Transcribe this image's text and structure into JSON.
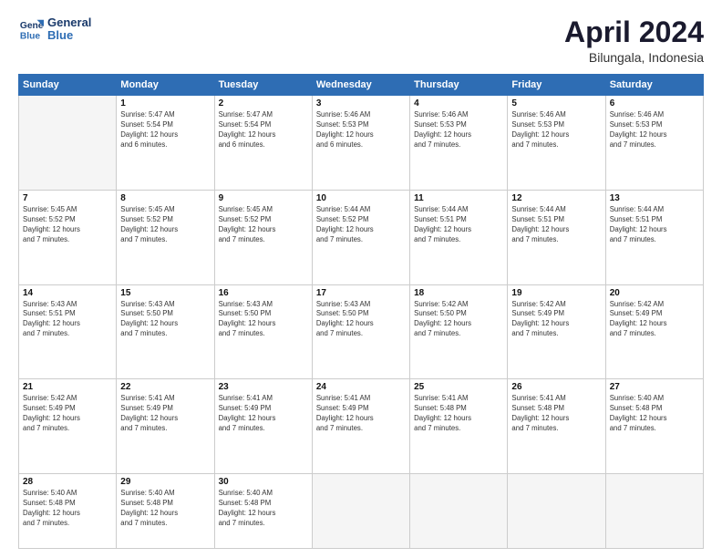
{
  "logo": {
    "line1": "General",
    "line2": "Blue"
  },
  "title": "April 2024",
  "subtitle": "Bilungala, Indonesia",
  "weekdays": [
    "Sunday",
    "Monday",
    "Tuesday",
    "Wednesday",
    "Thursday",
    "Friday",
    "Saturday"
  ],
  "weeks": [
    [
      {
        "day": "",
        "info": ""
      },
      {
        "day": "1",
        "info": "Sunrise: 5:47 AM\nSunset: 5:54 PM\nDaylight: 12 hours\nand 6 minutes."
      },
      {
        "day": "2",
        "info": "Sunrise: 5:47 AM\nSunset: 5:54 PM\nDaylight: 12 hours\nand 6 minutes."
      },
      {
        "day": "3",
        "info": "Sunrise: 5:46 AM\nSunset: 5:53 PM\nDaylight: 12 hours\nand 6 minutes."
      },
      {
        "day": "4",
        "info": "Sunrise: 5:46 AM\nSunset: 5:53 PM\nDaylight: 12 hours\nand 7 minutes."
      },
      {
        "day": "5",
        "info": "Sunrise: 5:46 AM\nSunset: 5:53 PM\nDaylight: 12 hours\nand 7 minutes."
      },
      {
        "day": "6",
        "info": "Sunrise: 5:46 AM\nSunset: 5:53 PM\nDaylight: 12 hours\nand 7 minutes."
      }
    ],
    [
      {
        "day": "7",
        "info": "Sunrise: 5:45 AM\nSunset: 5:52 PM\nDaylight: 12 hours\nand 7 minutes."
      },
      {
        "day": "8",
        "info": "Sunrise: 5:45 AM\nSunset: 5:52 PM\nDaylight: 12 hours\nand 7 minutes."
      },
      {
        "day": "9",
        "info": "Sunrise: 5:45 AM\nSunset: 5:52 PM\nDaylight: 12 hours\nand 7 minutes."
      },
      {
        "day": "10",
        "info": "Sunrise: 5:44 AM\nSunset: 5:52 PM\nDaylight: 12 hours\nand 7 minutes."
      },
      {
        "day": "11",
        "info": "Sunrise: 5:44 AM\nSunset: 5:51 PM\nDaylight: 12 hours\nand 7 minutes."
      },
      {
        "day": "12",
        "info": "Sunrise: 5:44 AM\nSunset: 5:51 PM\nDaylight: 12 hours\nand 7 minutes."
      },
      {
        "day": "13",
        "info": "Sunrise: 5:44 AM\nSunset: 5:51 PM\nDaylight: 12 hours\nand 7 minutes."
      }
    ],
    [
      {
        "day": "14",
        "info": "Sunrise: 5:43 AM\nSunset: 5:51 PM\nDaylight: 12 hours\nand 7 minutes."
      },
      {
        "day": "15",
        "info": "Sunrise: 5:43 AM\nSunset: 5:50 PM\nDaylight: 12 hours\nand 7 minutes."
      },
      {
        "day": "16",
        "info": "Sunrise: 5:43 AM\nSunset: 5:50 PM\nDaylight: 12 hours\nand 7 minutes."
      },
      {
        "day": "17",
        "info": "Sunrise: 5:43 AM\nSunset: 5:50 PM\nDaylight: 12 hours\nand 7 minutes."
      },
      {
        "day": "18",
        "info": "Sunrise: 5:42 AM\nSunset: 5:50 PM\nDaylight: 12 hours\nand 7 minutes."
      },
      {
        "day": "19",
        "info": "Sunrise: 5:42 AM\nSunset: 5:49 PM\nDaylight: 12 hours\nand 7 minutes."
      },
      {
        "day": "20",
        "info": "Sunrise: 5:42 AM\nSunset: 5:49 PM\nDaylight: 12 hours\nand 7 minutes."
      }
    ],
    [
      {
        "day": "21",
        "info": "Sunrise: 5:42 AM\nSunset: 5:49 PM\nDaylight: 12 hours\nand 7 minutes."
      },
      {
        "day": "22",
        "info": "Sunrise: 5:41 AM\nSunset: 5:49 PM\nDaylight: 12 hours\nand 7 minutes."
      },
      {
        "day": "23",
        "info": "Sunrise: 5:41 AM\nSunset: 5:49 PM\nDaylight: 12 hours\nand 7 minutes."
      },
      {
        "day": "24",
        "info": "Sunrise: 5:41 AM\nSunset: 5:49 PM\nDaylight: 12 hours\nand 7 minutes."
      },
      {
        "day": "25",
        "info": "Sunrise: 5:41 AM\nSunset: 5:48 PM\nDaylight: 12 hours\nand 7 minutes."
      },
      {
        "day": "26",
        "info": "Sunrise: 5:41 AM\nSunset: 5:48 PM\nDaylight: 12 hours\nand 7 minutes."
      },
      {
        "day": "27",
        "info": "Sunrise: 5:40 AM\nSunset: 5:48 PM\nDaylight: 12 hours\nand 7 minutes."
      }
    ],
    [
      {
        "day": "28",
        "info": "Sunrise: 5:40 AM\nSunset: 5:48 PM\nDaylight: 12 hours\nand 7 minutes."
      },
      {
        "day": "29",
        "info": "Sunrise: 5:40 AM\nSunset: 5:48 PM\nDaylight: 12 hours\nand 7 minutes."
      },
      {
        "day": "30",
        "info": "Sunrise: 5:40 AM\nSunset: 5:48 PM\nDaylight: 12 hours\nand 7 minutes."
      },
      {
        "day": "",
        "info": ""
      },
      {
        "day": "",
        "info": ""
      },
      {
        "day": "",
        "info": ""
      },
      {
        "day": "",
        "info": ""
      }
    ]
  ]
}
